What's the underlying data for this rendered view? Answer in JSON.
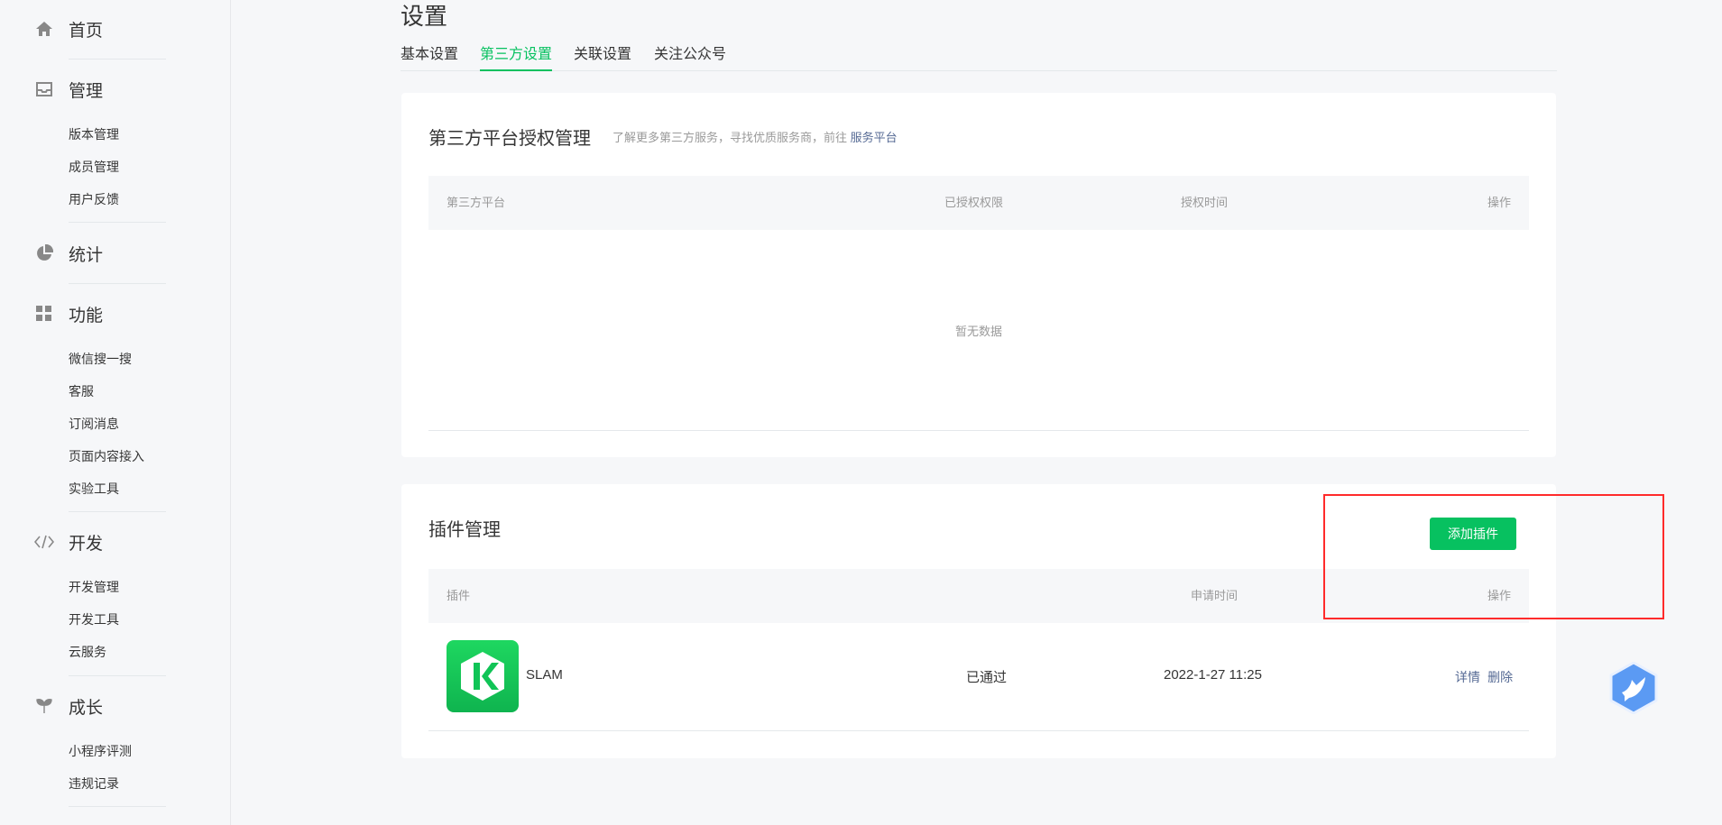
{
  "sidebar": {
    "home": "首页",
    "manage": {
      "label": "管理",
      "items": [
        "版本管理",
        "成员管理",
        "用户反馈"
      ]
    },
    "stats": "统计",
    "features": {
      "label": "功能",
      "items": [
        "微信搜一搜",
        "客服",
        "订阅消息",
        "页面内容接入",
        "实验工具"
      ]
    },
    "dev": {
      "label": "开发",
      "items": [
        "开发管理",
        "开发工具",
        "云服务"
      ]
    },
    "growth": {
      "label": "成长",
      "items": [
        "小程序评测",
        "违规记录"
      ]
    }
  },
  "page": {
    "title": "设置",
    "tabs": [
      {
        "label": "基本设置",
        "active": false
      },
      {
        "label": "第三方设置",
        "active": true
      },
      {
        "label": "关联设置",
        "active": false
      },
      {
        "label": "关注公众号",
        "active": false
      }
    ]
  },
  "third_party": {
    "title": "第三方平台授权管理",
    "desc": "了解更多第三方服务，寻找优质服务商，前往",
    "desc_link": "服务平台",
    "columns": [
      "第三方平台",
      "已授权权限",
      "授权时间",
      "操作"
    ],
    "empty": "暂无数据"
  },
  "plugins": {
    "title": "插件管理",
    "add_button": "添加插件",
    "columns": [
      "插件",
      "申请时间",
      "操作"
    ],
    "rows": [
      {
        "name": "SLAM",
        "status": "已通过",
        "time": "2022-1-27 11:25",
        "actions": [
          "详情",
          "删除"
        ]
      }
    ]
  },
  "colors": {
    "accent": "#07c160",
    "link": "#576b95",
    "highlight": "#ff2b2b"
  }
}
